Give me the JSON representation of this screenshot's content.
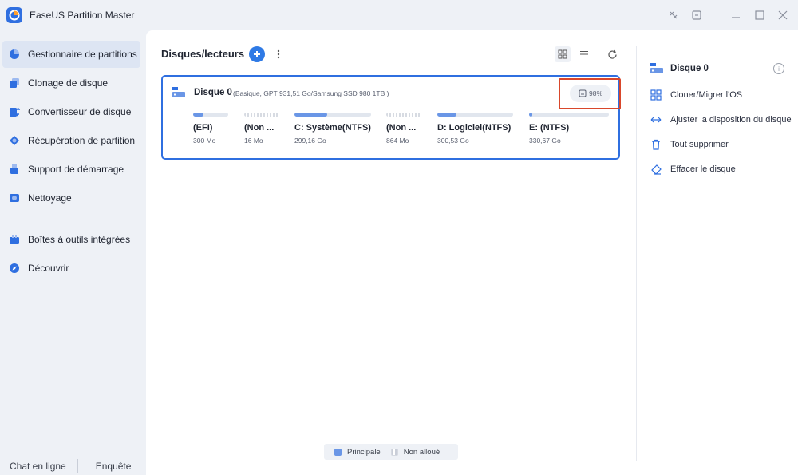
{
  "app": {
    "title": "EaseUS Partition Master"
  },
  "sidebar": {
    "items": [
      {
        "label": "Gestionnaire de partitions",
        "icon": "partition-manager-icon",
        "active": true
      },
      {
        "label": "Clonage de disque",
        "icon": "disk-clone-icon"
      },
      {
        "label": "Convertisseur de disque",
        "icon": "disk-converter-icon"
      },
      {
        "label": "Récupération de partition",
        "icon": "partition-recovery-icon"
      },
      {
        "label": "Support de démarrage",
        "icon": "boot-media-icon"
      },
      {
        "label": "Nettoyage",
        "icon": "cleanup-icon"
      },
      {
        "label": "Boîtes à outils intégrées",
        "icon": "toolbox-icon"
      },
      {
        "label": "Découvrir",
        "icon": "discover-icon"
      }
    ],
    "footer": {
      "chat": "Chat en ligne",
      "survey": "Enquête"
    }
  },
  "main": {
    "title": "Disques/lecteurs",
    "disk": {
      "name": "Disque 0",
      "info": "(Basique, GPT 931,51 Go/Samsung SSD 980 1TB )",
      "usage": "98%",
      "partitions": [
        {
          "name": "(EFI)",
          "size": "300 Mo",
          "fill": 0.3,
          "unallocated": false
        },
        {
          "name": "(Non ...",
          "size": "16 Mo",
          "fill": 0,
          "unallocated": true
        },
        {
          "name": "C: Système(NTFS)",
          "size": "299,16 Go",
          "fill": 0.43,
          "unallocated": false
        },
        {
          "name": "(Non ...",
          "size": "864 Mo",
          "fill": 0,
          "unallocated": true
        },
        {
          "name": "D: Logiciel(NTFS)",
          "size": "300,53 Go",
          "fill": 0.25,
          "unallocated": false
        },
        {
          "name": "E: (NTFS)",
          "size": "330,67 Go",
          "fill": 0.03,
          "unallocated": false
        }
      ]
    },
    "legend": {
      "primary": "Principale",
      "unallocated": "Non alloué"
    }
  },
  "right_panel": {
    "title": "Disque 0",
    "actions": [
      {
        "label": "Cloner/Migrer l'OS",
        "icon": "clone-os-icon"
      },
      {
        "label": "Ajuster la disposition du disque",
        "icon": "adjust-layout-icon"
      },
      {
        "label": "Tout supprimer",
        "icon": "trash-icon"
      },
      {
        "label": "Effacer le disque",
        "icon": "eraser-icon"
      }
    ]
  },
  "colors": {
    "accent": "#2f6fe0",
    "highlight": "#d9472b",
    "primary_partition": "#6a96e6"
  }
}
